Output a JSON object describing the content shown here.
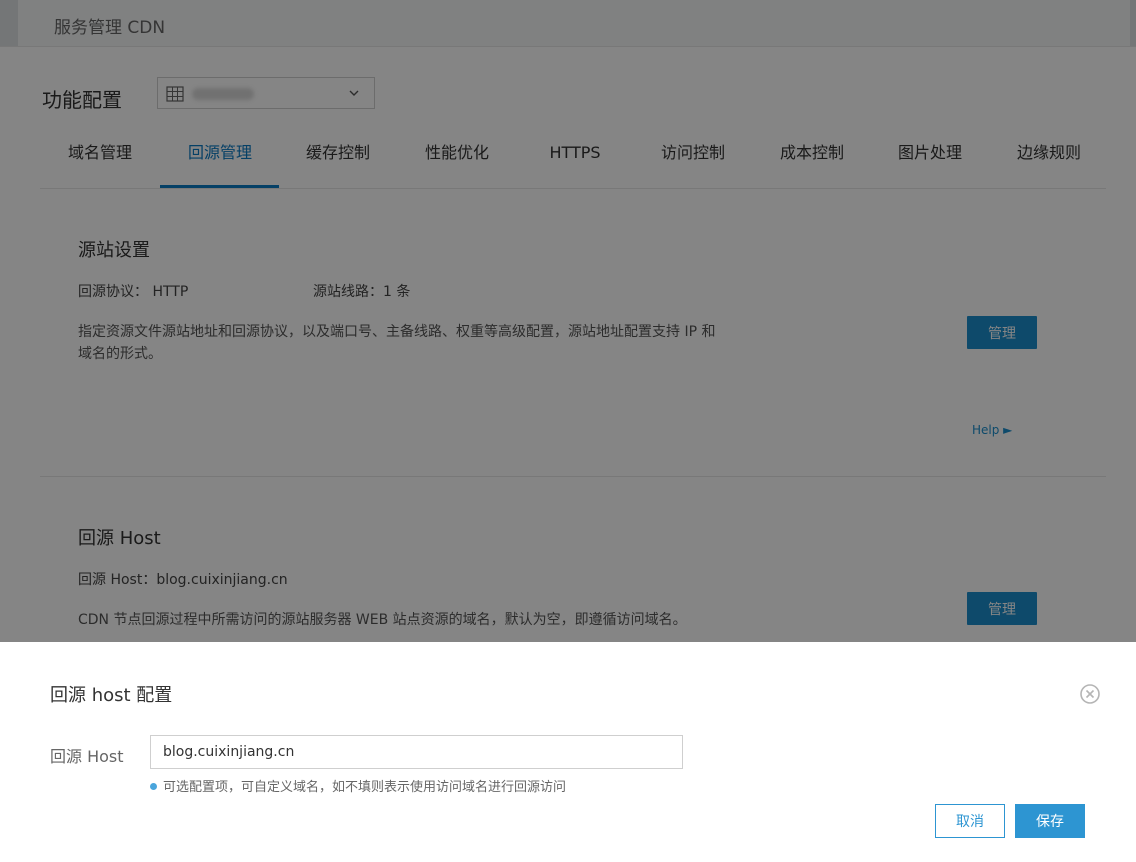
{
  "header": {
    "breadcrumb": "服务管理 CDN"
  },
  "config": {
    "title": "功能配置"
  },
  "tabs": [
    {
      "label": "域名管理"
    },
    {
      "label": "回源管理"
    },
    {
      "label": "缓存控制"
    },
    {
      "label": "性能优化"
    },
    {
      "label": "HTTPS"
    },
    {
      "label": "访问控制"
    },
    {
      "label": "成本控制"
    },
    {
      "label": "图片处理"
    },
    {
      "label": "边缘规则"
    }
  ],
  "active_tab": "回源管理",
  "origin_settings": {
    "title": "源站设置",
    "protocol": "回源协议： HTTP",
    "lines": "源站线路：1 条",
    "desc_line1": "指定资源文件源站地址和回源协议，以及端口号、主备线路、权重等高级配置，源站地址配置支持 IP 和",
    "desc_line2": "域名的形式。",
    "manage_label": "管理",
    "help_label": "Help ►"
  },
  "origin_host": {
    "title": "回源 Host",
    "value_line": "回源 Host：blog.cuixinjiang.cn",
    "desc": "CDN 节点回源过程中所需访问的源站服务器 WEB 站点资源的域名，默认为空，即遵循访问域名。",
    "manage_label": "管理"
  },
  "modal": {
    "title": "回源 host 配置",
    "field_label": "回源 Host",
    "field_value": "blog.cuixinjiang.cn",
    "hint": "可选配置项，可自定义域名，如不填则表示使用访问域名进行回源访问",
    "cancel_label": "取消",
    "save_label": "保存"
  },
  "colors": {
    "accent": "#0b7bc4",
    "button": "#1b8fcd",
    "modal_button": "#2d95d2"
  },
  "icons": {
    "domain": "domain-grid-icon",
    "dropdown": "chevron-down-icon",
    "close": "close-circle-icon"
  }
}
